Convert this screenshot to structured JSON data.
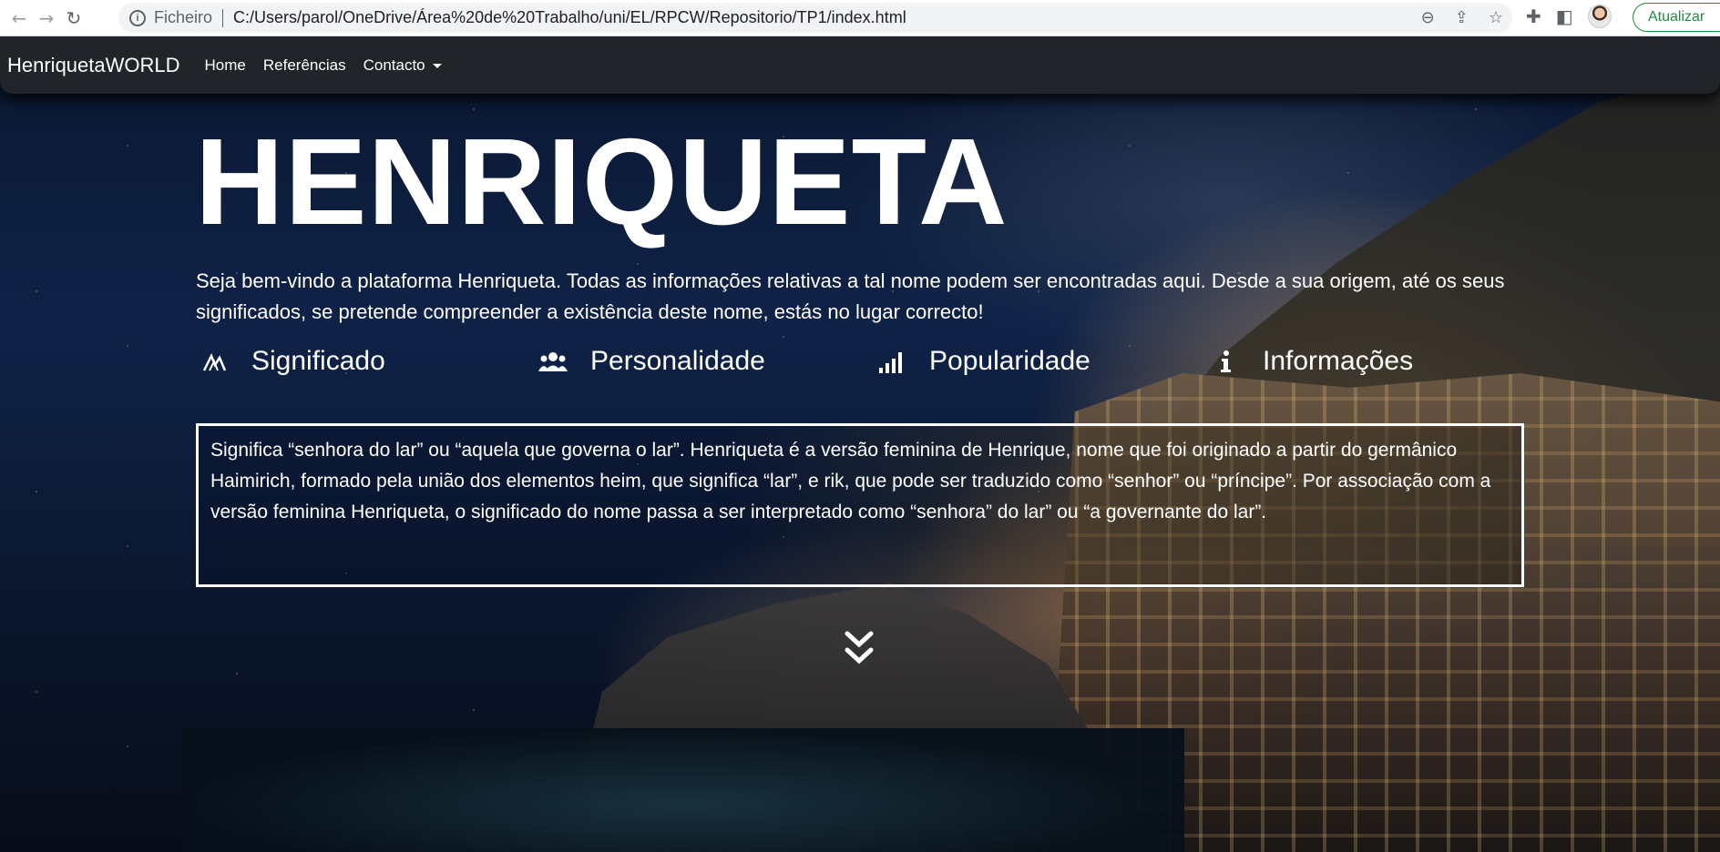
{
  "browser": {
    "scheme_label": "Ficheiro",
    "url": "C:/Users/parol/OneDrive/Área%20de%20Trabalho/uni/EL/RPCW/Repositorio/TP1/index.html",
    "update_label": "Atualizar",
    "icons": [
      "back-arrow-icon",
      "forward-arrow-icon",
      "reload-icon",
      "info-icon",
      "zoom-icon",
      "share-icon",
      "star-icon",
      "extensions-icon",
      "side-panel-icon",
      "avatar"
    ]
  },
  "site_nav": {
    "brand": "HenriquetaWORLD",
    "links": [
      "Home",
      "Referências",
      "Contacto"
    ]
  },
  "hero": {
    "title": "HENRIQUETA",
    "intro": "Seja bem-vindo a plataforma Henriqueta. Todas as informações relativas a tal nome podem ser encontradas aqui. Desde a sua origem, até os seus significados, se pretende compreender a existência deste nome, estás no lugar correcto!"
  },
  "tabs": [
    {
      "label": "Significado",
      "icon": "signature-icon"
    },
    {
      "label": "Personalidade",
      "icon": "users-icon"
    },
    {
      "label": "Popularidade",
      "icon": "signal-bars-icon"
    },
    {
      "label": "Informações",
      "icon": "info-icon"
    }
  ],
  "content": {
    "text": "Significa “senhora do lar” ou “aquela que governa o lar”. Henriqueta é a versão feminina de Henrique, nome que foi originado a partir do germânico Haimirich, formado pela união dos elementos heim, que significa “lar”, e rik, que pode ser traduzido como “senhor” ou “príncipe”. Por associação com a versão feminina Henriqueta, o significado do nome passa a ser interpretado como “senhora” do lar” ou “a governante do lar”."
  },
  "colors": {
    "navbar": "#212529",
    "update_green": "#1e8e3e",
    "text": "#ffffff"
  }
}
